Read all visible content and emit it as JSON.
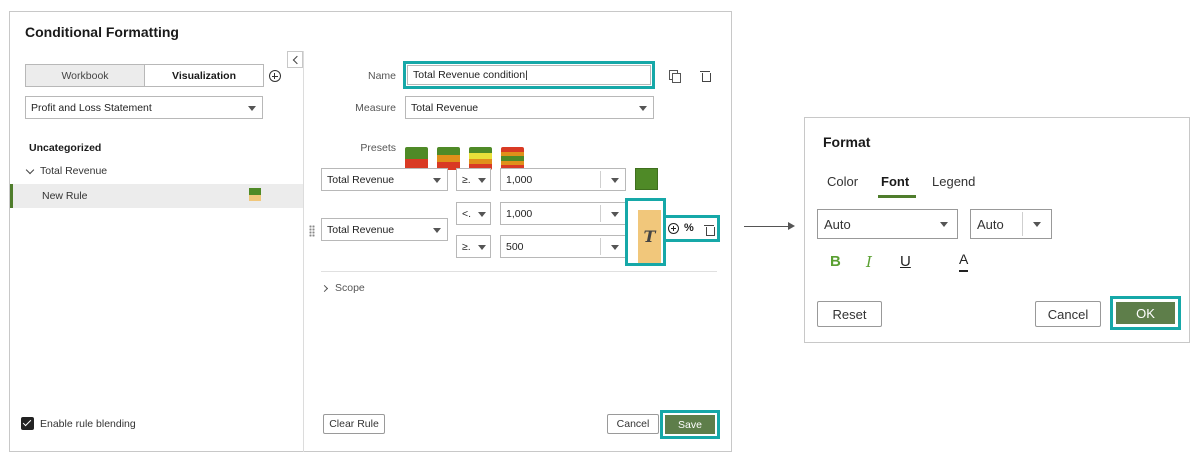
{
  "dialog": {
    "title": "Conditional Formatting",
    "segments": [
      "Workbook",
      "Visualization"
    ],
    "report_select": "Profit and Loss Statement",
    "section_label": "Uncategorized",
    "tree_parent": "Total Revenue",
    "tree_item": "New Rule",
    "enable_blending": "Enable rule blending",
    "name_label": "Name",
    "name_value": "Total Revenue condition",
    "measure_label": "Measure",
    "measure_value": "Total Revenue",
    "presets_label": "Presets",
    "rule1": {
      "measure": "Total Revenue",
      "op": "≥.",
      "value": "1,000"
    },
    "rule2": {
      "measure": "Total Revenue",
      "op1": "<.",
      "value1": "1,000",
      "op2": "≥.",
      "value2": "500"
    },
    "font_swatch_glyph": "T",
    "percent_glyph": "%",
    "scope_label": "Scope",
    "clear_rule": "Clear Rule",
    "cancel": "Cancel",
    "save": "Save"
  },
  "format": {
    "title": "Format",
    "tabs": [
      "Color",
      "Font",
      "Legend"
    ],
    "active_tab": "Font",
    "font_family": "Auto",
    "font_size": "Auto",
    "bold": "B",
    "italic": "I",
    "underline": "U",
    "font_color_glyph": "A",
    "reset": "Reset",
    "cancel": "Cancel",
    "ok": "OK"
  },
  "colors": {
    "accent_teal": "#16a8a8",
    "primary_green": "#5e7e4a",
    "swatch_green": "#4f8a27",
    "font_swatch": "#f1c77b"
  },
  "icons": [
    "collapse-left-icon",
    "add-circle-icon",
    "copy-icon",
    "trash-icon",
    "drag-handle-icon",
    "chevron-down-icon",
    "chevron-right-icon",
    "checkbox-icon",
    "arrow-right-icon"
  ]
}
